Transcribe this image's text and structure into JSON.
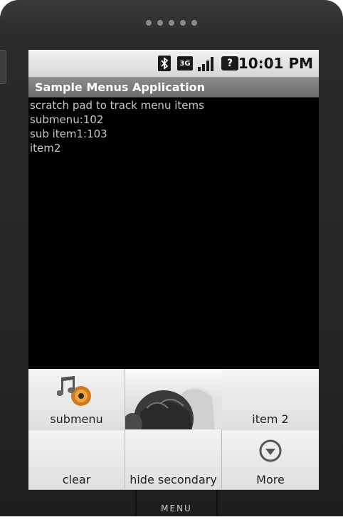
{
  "status_bar": {
    "network": "3G",
    "time": "10:01 PM"
  },
  "app": {
    "title": "Sample Menus Application"
  },
  "content_lines": [
    "scratch pad to track menu items",
    "submenu:102",
    "sub item1:103",
    "item2"
  ],
  "options_menu": {
    "items": [
      {
        "label": "submenu",
        "icon": "music-icon"
      },
      {
        "label": "",
        "icon": "hot-air-balloon-image"
      },
      {
        "label": "item 2",
        "icon": ""
      },
      {
        "label": "clear",
        "icon": ""
      },
      {
        "label": "hide secondary",
        "icon": ""
      },
      {
        "label": "More",
        "icon": "more-chevron-icon"
      }
    ]
  },
  "hardware": {
    "menu_label": "MENU"
  }
}
